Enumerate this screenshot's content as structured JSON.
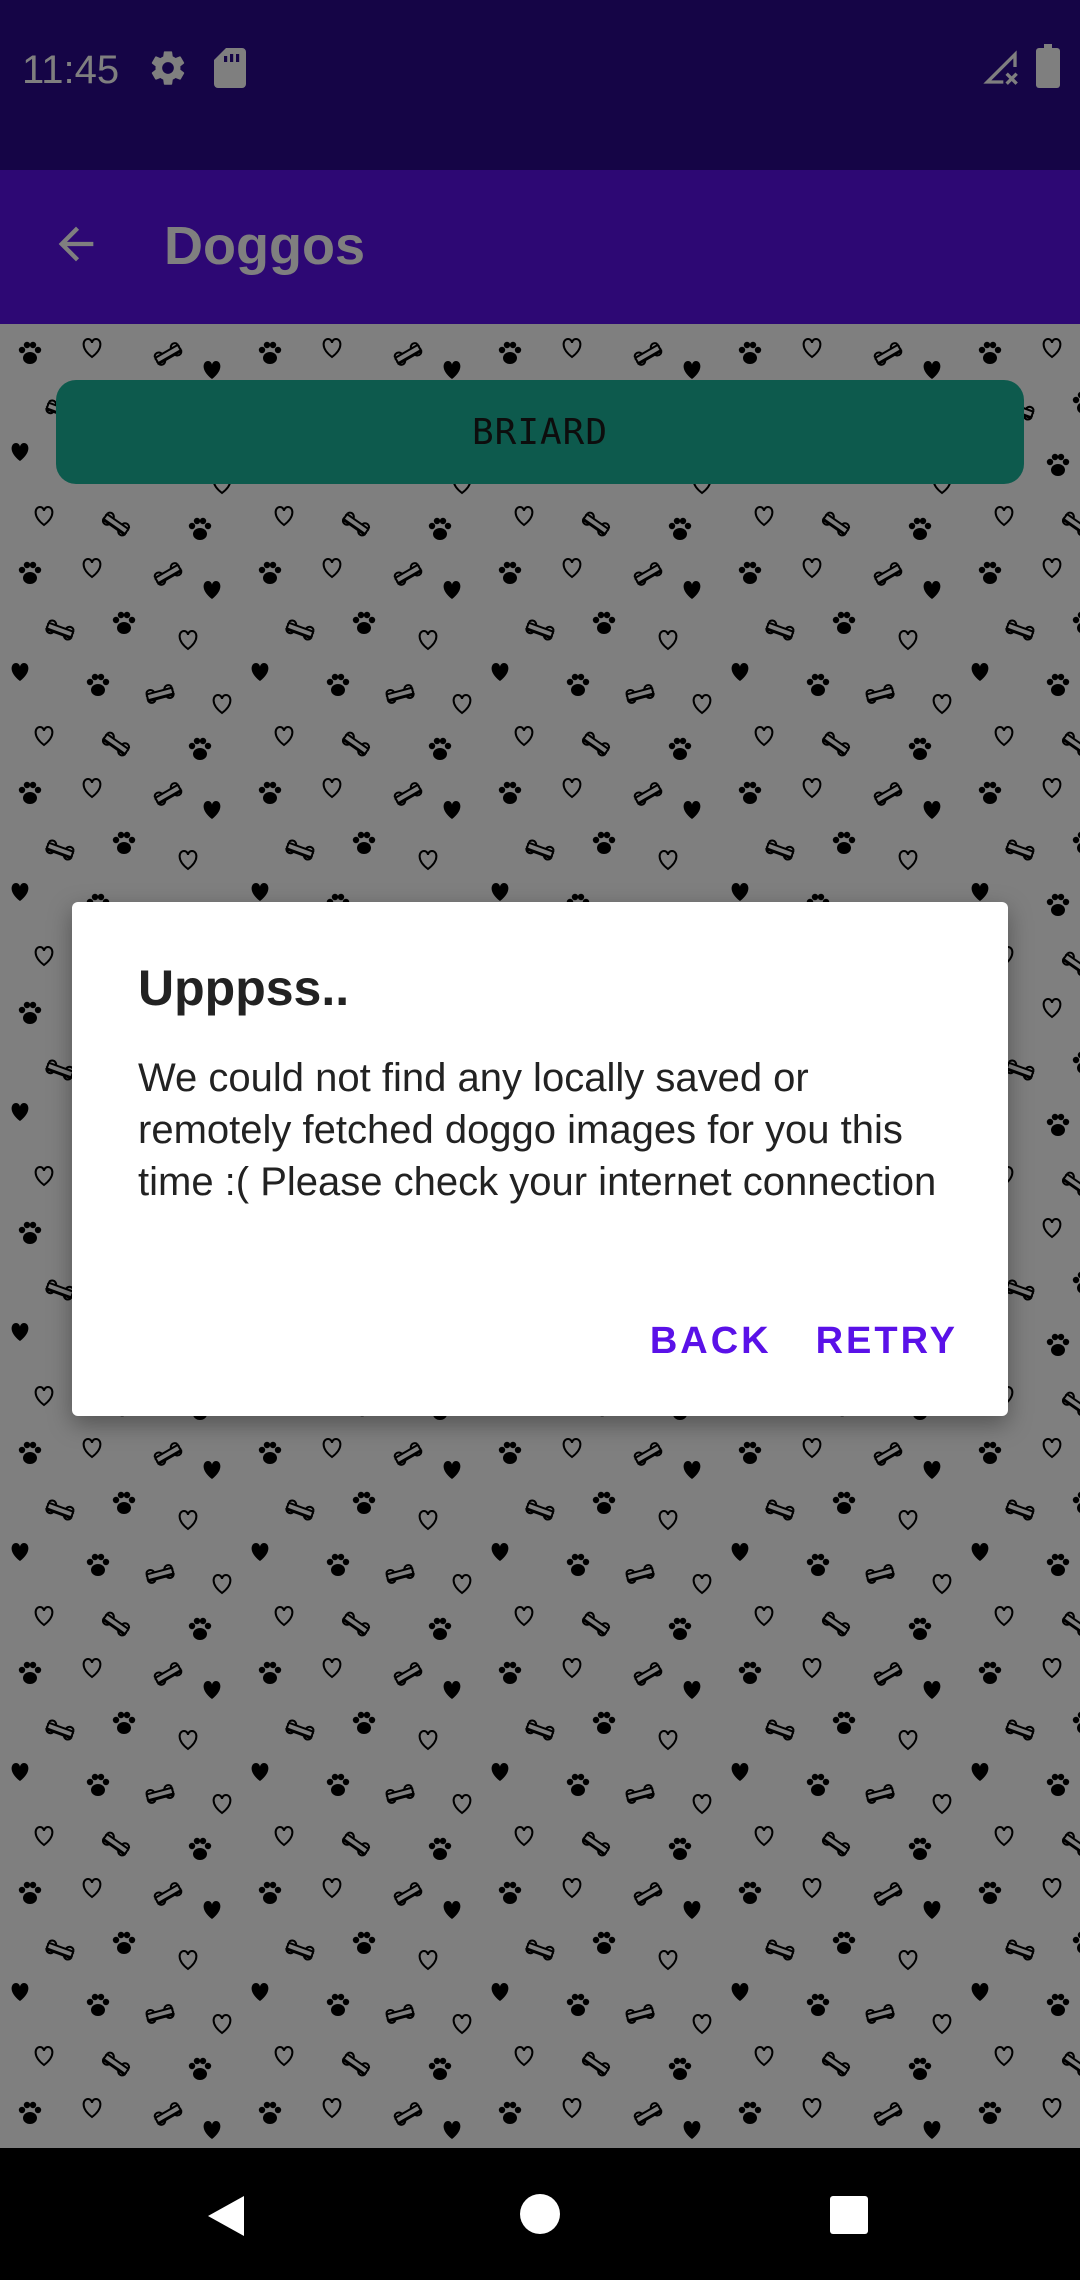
{
  "status_bar": {
    "time": "11:45",
    "icons": [
      "gear-icon",
      "sd-card-icon",
      "signal-no-data-icon",
      "battery-icon"
    ]
  },
  "app_bar": {
    "title": "Doggos",
    "back_icon": "arrow-back-icon"
  },
  "content": {
    "breed_button_label": "BRIARD",
    "background_pattern": [
      "paw-icon",
      "heart-icon",
      "bone-icon"
    ]
  },
  "dialog": {
    "title": "Upppss..",
    "message": "We could not find any locally saved or remotely fetched doggo images for you this time :( Please check your internet connection",
    "back_label": "BACK",
    "retry_label": "RETRY"
  },
  "nav_bar": {
    "icons": [
      "nav-back-icon",
      "nav-home-icon",
      "nav-recent-icon"
    ]
  },
  "colors": {
    "status_bar": "#2a0a8c",
    "app_bar": "#5a11e8",
    "accent": "#5a11e8",
    "breed_button": "#1bb59a"
  }
}
